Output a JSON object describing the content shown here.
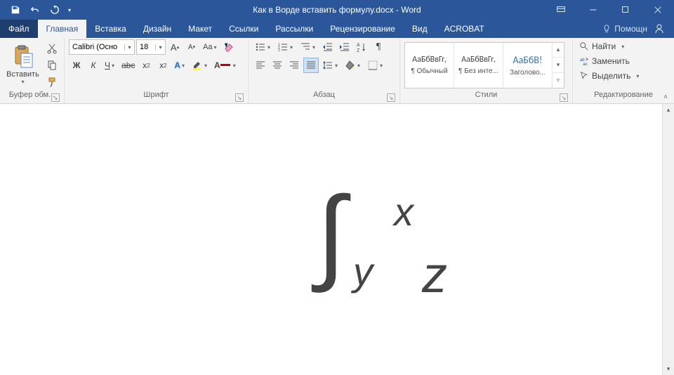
{
  "titlebar": {
    "document_title": "Как в Ворде вставить формулу.docx - Word"
  },
  "tabs": {
    "file": "Файл",
    "items": [
      "Главная",
      "Вставка",
      "Дизайн",
      "Макет",
      "Ссылки",
      "Рассылки",
      "Рецензирование",
      "Вид",
      "ACROBAT"
    ],
    "active_index": 0,
    "tell_me": "Помощн"
  },
  "ribbon": {
    "clipboard": {
      "paste": "Вставить",
      "group_label": "Буфер обм..."
    },
    "font": {
      "name": "Calibri (Осно",
      "size": "18",
      "group_label": "Шрифт",
      "bold": "Ж",
      "italic": "К",
      "underline": "Ч",
      "strike": "abc",
      "sub": "x",
      "sup": "x"
    },
    "paragraph": {
      "group_label": "Абзац"
    },
    "styles": {
      "group_label": "Стили",
      "items": [
        {
          "preview": "АаБбВвГг,",
          "name": "¶ Обычный",
          "color": "#333"
        },
        {
          "preview": "АаБбВвГг,",
          "name": "¶ Без инте...",
          "color": "#333"
        },
        {
          "preview": "АаБбВ!",
          "name": "Заголово...",
          "color": "#2e74b5"
        }
      ]
    },
    "editing": {
      "group_label": "Редактирование",
      "find": "Найти",
      "replace": "Заменить",
      "select": "Выделить"
    }
  },
  "equation": {
    "upper": "x",
    "lower": "y",
    "body": "z"
  }
}
